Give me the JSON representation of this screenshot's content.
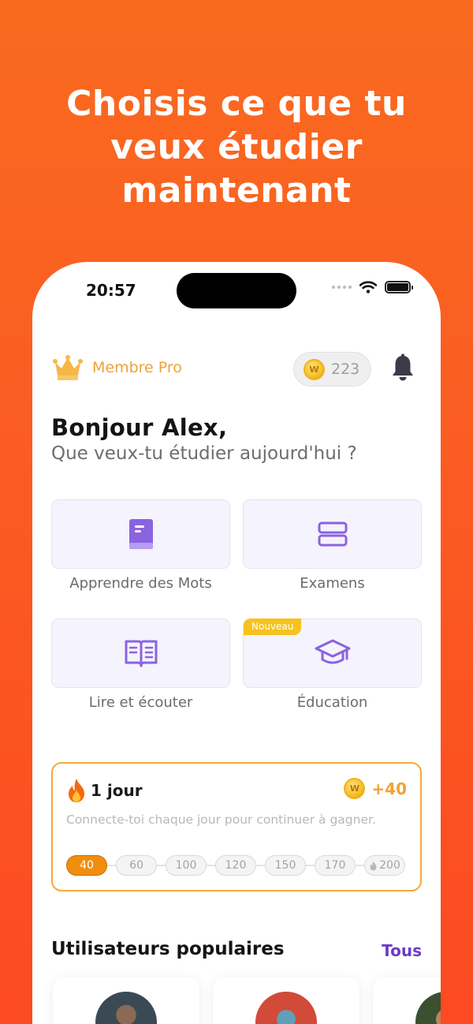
{
  "headline": [
    "Choisis ce que tu",
    "veux étudier",
    "maintenant"
  ],
  "status": {
    "time": "20:57"
  },
  "header": {
    "pro_label": "Membre Pro",
    "coins": "223",
    "coin_glyph": "W"
  },
  "greeting": {
    "hello": "Bonjour Alex,",
    "question": "Que veux-tu étudier aujourd'hui ?"
  },
  "categories": [
    {
      "label": "Apprendre des Mots",
      "icon": "book-icon"
    },
    {
      "label": "Examens",
      "icon": "stack-icon"
    },
    {
      "label": "Lire et écouter",
      "icon": "open-book-icon"
    },
    {
      "label": "Éducation",
      "icon": "graduation-cap-icon",
      "badge": "Nouveau"
    }
  ],
  "streak": {
    "title": "1 jour",
    "reward": "+40",
    "description": "Connecte-toi chaque jour pour continuer à gagner.",
    "steps": [
      "40",
      "60",
      "100",
      "120",
      "150",
      "170",
      "200"
    ],
    "active_step": 0
  },
  "popular": {
    "title": "Utilisateurs populaires",
    "see_all": "Tous"
  },
  "colors": {
    "accent": "#f0a23a",
    "brand_purple": "#8a63e0",
    "link": "#6a3cc6",
    "background": "#fb5a22"
  }
}
